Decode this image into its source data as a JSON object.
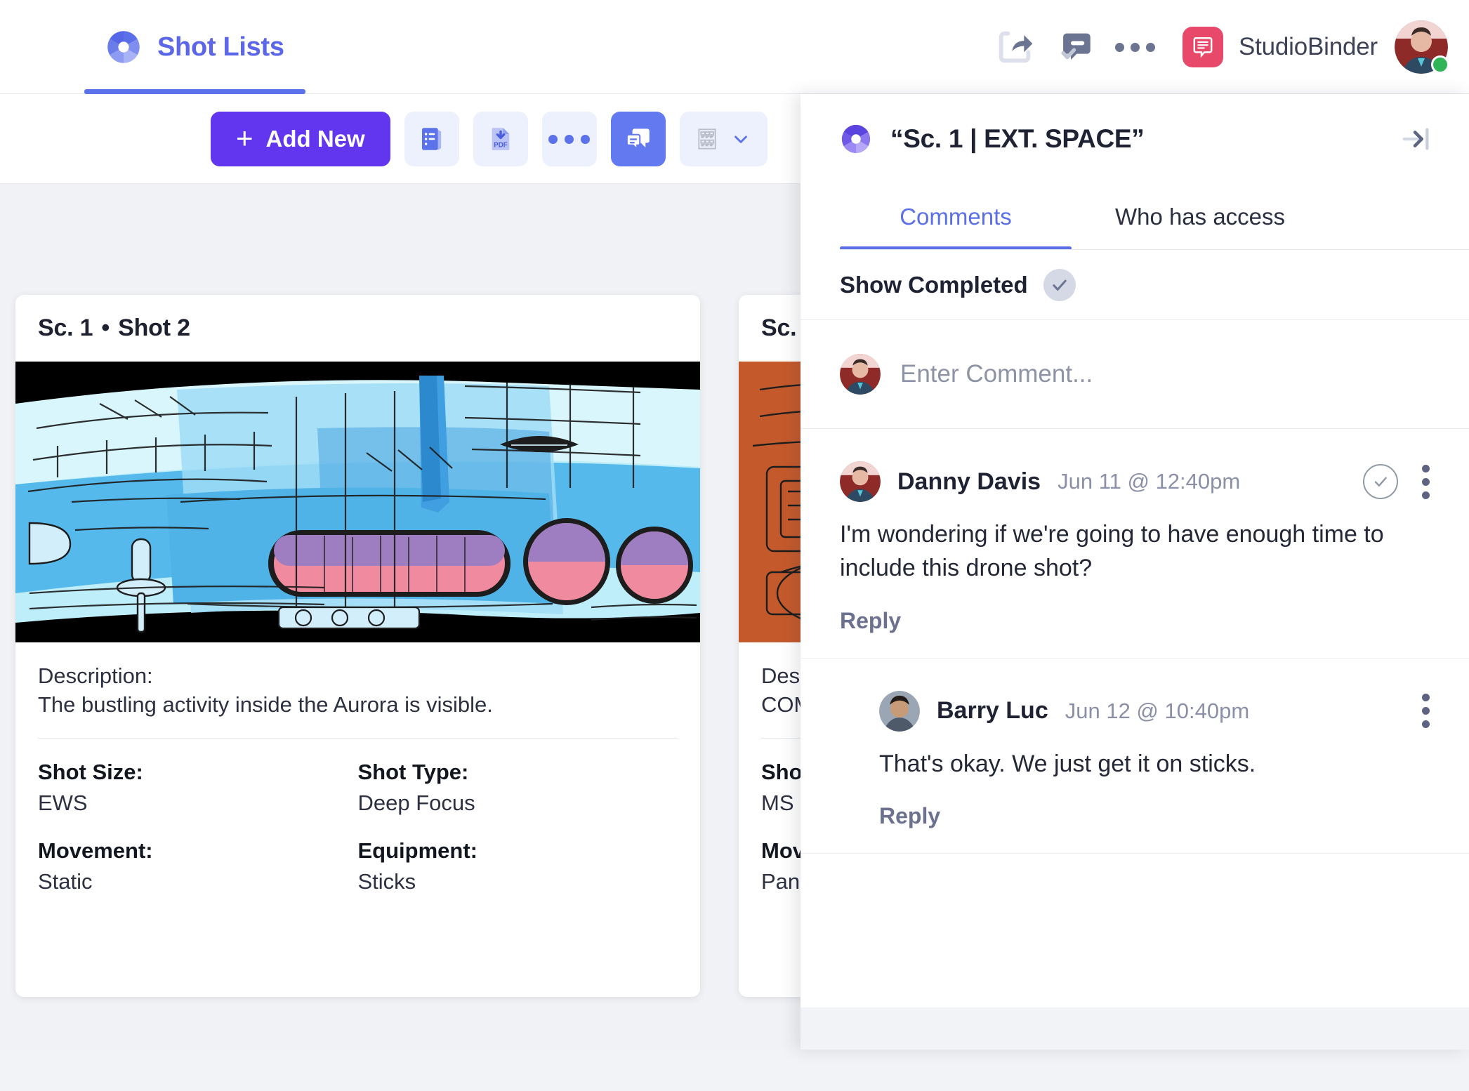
{
  "header": {
    "brand_tab_label": "Shot Lists",
    "brand_icon": "aperture-icon",
    "share_icon": "share-icon",
    "feedback_icon": "feedback-approve-icon",
    "more_icon": "more-horizontal-icon",
    "studio_name": "StudioBinder",
    "studio_badge_icon": "studiobinder-chat-icon",
    "avatar_icon": "user-avatar",
    "status": "online"
  },
  "toolbar": {
    "add_new_label": "Add New",
    "add_new_plus": "+",
    "list_view_icon": "list-view-icon",
    "pdf_icon": "pdf-download-icon",
    "more_icon": "more-horizontal-icon",
    "comments_icon": "comments-icon",
    "layout_icon": "grid-layout-icon",
    "chevron_icon": "chevron-down-icon"
  },
  "cards": [
    {
      "scene": "Sc. 1",
      "separator": "•",
      "shot": "Shot  2",
      "image_alt": "spaceship-interior-storyboard",
      "description_label": "Description:",
      "description_text": "The bustling activity inside the Aurora is visible.",
      "fields": [
        {
          "key": "Shot Size:",
          "value": "EWS"
        },
        {
          "key": "Shot Type:",
          "value": "Deep Focus"
        },
        {
          "key": "Movement:",
          "value": "Static"
        },
        {
          "key": "Equipment:",
          "value": "Sticks"
        }
      ]
    },
    {
      "scene": "Sc.",
      "separator": "",
      "shot": "",
      "image_alt": "orange-machinery-storyboard",
      "description_label": "Des",
      "description_text": "COM",
      "fields": [
        {
          "key": "Sho",
          "value": "MS"
        },
        {
          "key": "",
          "value": ""
        },
        {
          "key": "Mov",
          "value": "Pan"
        },
        {
          "key": "",
          "value": ""
        }
      ]
    }
  ],
  "panel": {
    "title": "“Sc. 1 | EXT. SPACE”",
    "title_icon": "aperture-icon",
    "collapse_icon": "collapse-panel-right-icon",
    "tabs": [
      {
        "label": "Comments",
        "active": true
      },
      {
        "label": "Who has access",
        "active": false
      }
    ],
    "show_completed_label": "Show Completed",
    "show_completed_icon": "check-icon",
    "composer_placeholder": "Enter Comment...",
    "composer_value": "",
    "composer_avatar": "user-avatar",
    "comments": [
      {
        "author": "Danny Davis",
        "avatar": "danny-avatar",
        "timestamp": "Jun 11 @ 12:40pm",
        "body": "I'm wondering if we're going to have enough time to include this drone shot?",
        "reply_label": "Reply",
        "resolve_icon": "check-circle-icon",
        "menu_icon": "kebab-menu-icon",
        "is_reply": false
      },
      {
        "author": "Barry Luc",
        "avatar": "barry-avatar",
        "timestamp": "Jun 12 @ 10:40pm",
        "body": "That's okay. We just get it on sticks.",
        "reply_label": "Reply",
        "menu_icon": "kebab-menu-icon",
        "is_reply": true
      }
    ]
  },
  "colors": {
    "brand_purple": "#6236ef",
    "accent_blue": "#5b72ea",
    "badge_red": "#e8496a",
    "status_green": "#2fb457",
    "canvas_bg": "#f1f2f5"
  }
}
